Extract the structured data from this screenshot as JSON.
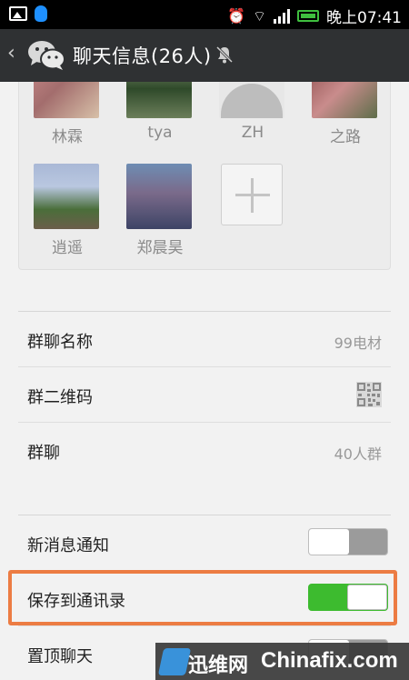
{
  "status_bar": {
    "time": "晚上07:41",
    "icons": [
      "image-icon",
      "qq-icon",
      "alarm-icon",
      "wifi-icon",
      "signal-icon",
      "battery-icon"
    ]
  },
  "header": {
    "back_icon": "chevron-left-icon",
    "title": "聊天信息(26人)",
    "muted_icon": "bell-off-icon"
  },
  "members": [
    {
      "name": "林霖"
    },
    {
      "name": "tya"
    },
    {
      "name": "ZH"
    },
    {
      "name": "之路"
    },
    {
      "name": "逍遥"
    },
    {
      "name": "郑晨昊"
    }
  ],
  "group_info": [
    {
      "label": "群聊名称",
      "value": "99电材"
    },
    {
      "label": "群二维码",
      "value": ""
    },
    {
      "label": "群聊",
      "value": "40人群"
    }
  ],
  "settings": [
    {
      "label": "新消息通知",
      "enabled": false
    },
    {
      "label": "保存到通讯录",
      "enabled": true
    },
    {
      "label": "置顶聊天",
      "enabled": false
    }
  ],
  "watermark": {
    "brand_cn": "迅维网",
    "brand_en": "Chinafix.com"
  },
  "colors": {
    "header_bg": "#2f3133",
    "toggle_on": "#3dbb2f",
    "highlight": "#ec7c43"
  }
}
